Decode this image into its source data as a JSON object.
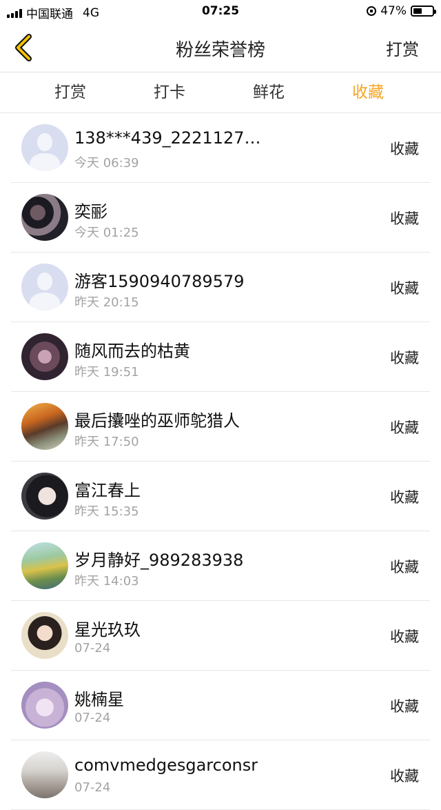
{
  "status_bar": {
    "carrier": "中国联通",
    "network": "4G",
    "time": "07:25",
    "battery": "47%"
  },
  "nav": {
    "title": "粉丝荣誉榜",
    "action": "打赏"
  },
  "tabs": [
    {
      "label": "打赏",
      "active": false
    },
    {
      "label": "打卡",
      "active": false
    },
    {
      "label": "鲜花",
      "active": false
    },
    {
      "label": "收藏",
      "active": true
    }
  ],
  "colors": {
    "accent": "#f5a623",
    "divider": "#e6e6e6",
    "muted_text": "#a3a3a3"
  },
  "list": [
    {
      "name": "138***439_2221127…",
      "time": "今天 06:39",
      "action": "收藏"
    },
    {
      "name": "奕彨",
      "time": "今天 01:25",
      "action": "收藏"
    },
    {
      "name": "游客1590940789579",
      "time": "昨天 20:15",
      "action": "收藏"
    },
    {
      "name": "随风而去的枯黄",
      "time": "昨天 19:51",
      "action": "收藏"
    },
    {
      "name": "最后攮唑的巫师鸵猎人",
      "time": "昨天 17:50",
      "action": "收藏"
    },
    {
      "name": "富江春上",
      "time": "昨天 15:35",
      "action": "收藏"
    },
    {
      "name": "岁月静好_989283938",
      "time": "昨天 14:03",
      "action": "收藏"
    },
    {
      "name": "星光玖玖",
      "time": "07-24",
      "action": "收藏"
    },
    {
      "name": "姚楠星",
      "time": "07-24",
      "action": "收藏"
    },
    {
      "name": "comvmedgesgarconsr",
      "time": "07-24",
      "action": "收藏"
    }
  ]
}
